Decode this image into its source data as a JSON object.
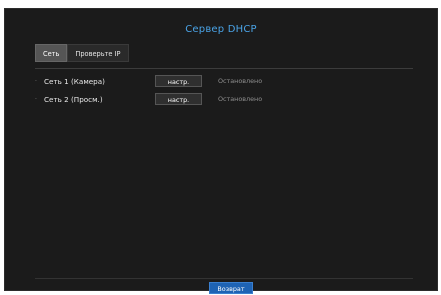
{
  "title": "Сервер DHCP",
  "tabs": [
    {
      "label": "Сеть",
      "active": true
    },
    {
      "label": "Проверьте IP",
      "active": false
    }
  ],
  "rows": [
    {
      "label": "Сеть 1 (Камера)",
      "button": "настр.",
      "status": "Остановлено"
    },
    {
      "label": "Сеть 2 (Просм.)",
      "button": "настр.",
      "status": "Остановлено"
    }
  ],
  "footer": {
    "back_label": "Возврат"
  },
  "colors": {
    "background": "#1b1b1b",
    "title": "#4aa3e6",
    "primary_button": "#1e63b4",
    "active_tab": "#555555",
    "status_text": "#8f8f8f"
  }
}
